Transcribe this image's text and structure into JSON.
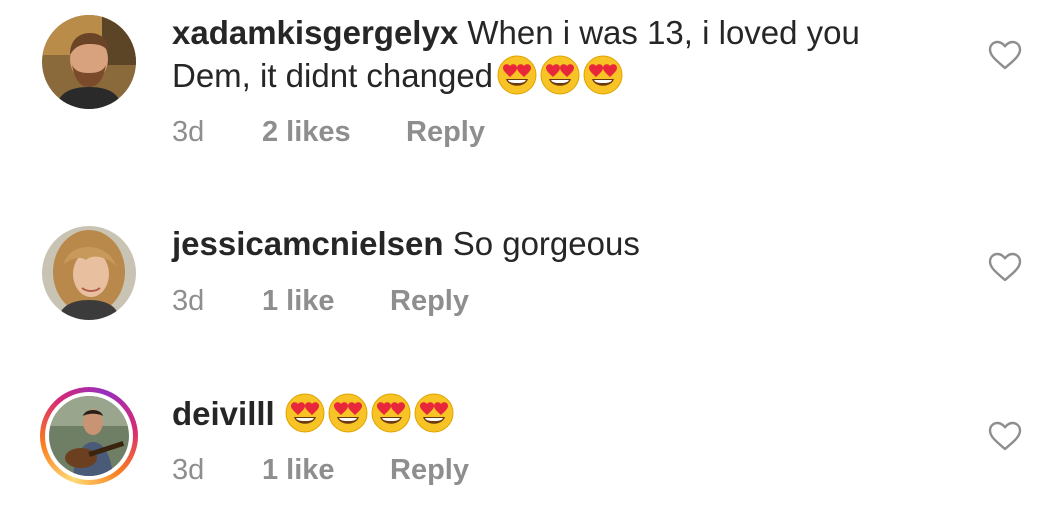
{
  "comments": [
    {
      "username": "xadamkisgergelyx",
      "text": "When i was 13, i loved you Dem, it didnt changed",
      "emojis": [
        "heart-eyes",
        "heart-eyes",
        "heart-eyes"
      ],
      "time": "3d",
      "likes": "2 likes",
      "reply": "Reply"
    },
    {
      "username": "jessicamcnielsen",
      "text": "So gorgeous",
      "emojis": [],
      "time": "3d",
      "likes": "1 like",
      "reply": "Reply"
    },
    {
      "username": "deivilll",
      "text": "",
      "emojis": [
        "heart-eyes",
        "heart-eyes",
        "heart-eyes",
        "heart-eyes"
      ],
      "time": "3d",
      "likes": "1 like",
      "reply": "Reply"
    }
  ],
  "colors": {
    "text": "#262626",
    "meta": "#8e8e8e",
    "heart_outline": "#8e8e8e",
    "story_ring_start": "#feda75",
    "story_ring_end": "#962fbf"
  }
}
